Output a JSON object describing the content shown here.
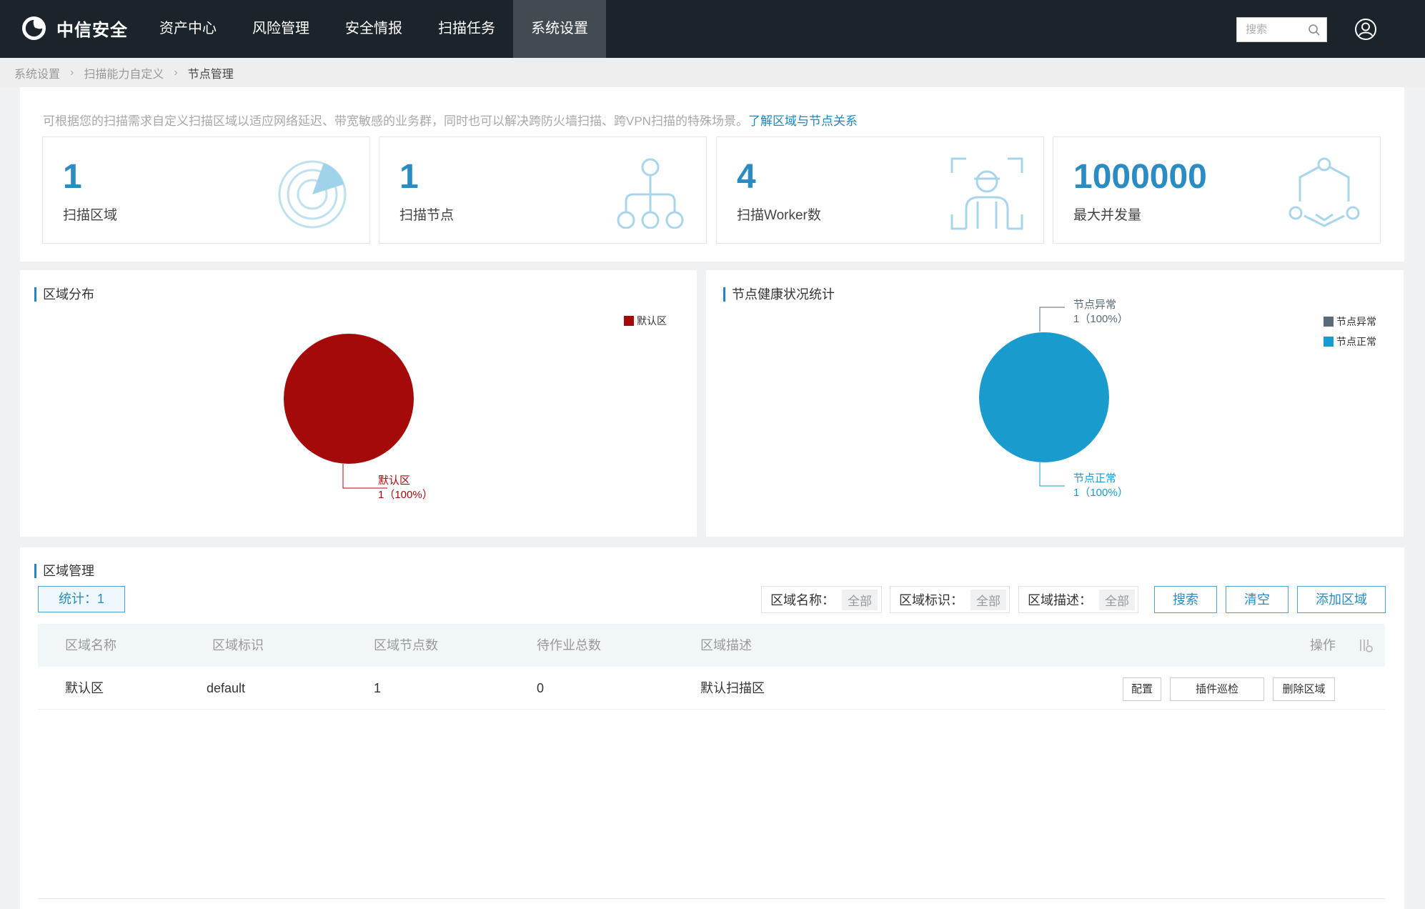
{
  "header": {
    "brand": "中信安全",
    "nav": [
      {
        "label": "资产中心",
        "active": false
      },
      {
        "label": "风险管理",
        "active": false
      },
      {
        "label": "安全情报",
        "active": false
      },
      {
        "label": "扫描任务",
        "active": false
      },
      {
        "label": "系统设置",
        "active": true
      }
    ],
    "search_placeholder": "搜索",
    "icons": {
      "search": "search-icon",
      "user": "user-icon",
      "logo": "logo-icon"
    }
  },
  "breadcrumb": [
    "系统设置",
    "扫描能力自定义",
    "节点管理"
  ],
  "intro": {
    "text": "可根据您的扫描需求自定义扫描区域以适应网络延迟、带宽敏感的业务群，同时也可以解决跨防火墙扫描、跨VPN扫描的特殊场景。",
    "link": "了解区域与节点关系"
  },
  "stats": [
    {
      "value": "1",
      "label": "扫描区域",
      "icon": "radar-icon"
    },
    {
      "value": "1",
      "label": "扫描节点",
      "icon": "node-tree-icon"
    },
    {
      "value": "4",
      "label": "扫描Worker数",
      "icon": "worker-icon"
    },
    {
      "value": "1000000",
      "label": "最大并发量",
      "icon": "concurrency-icon"
    }
  ],
  "zone_chart": {
    "title": "区域分布",
    "legend": [
      {
        "label": "默认区",
        "color": "#a50a0a"
      }
    ],
    "callout_name": "默认区",
    "callout_value": "1（100%）"
  },
  "health_chart": {
    "title": "节点健康状况统计",
    "legend": [
      {
        "label": "节点异常",
        "color": "#596a7a"
      },
      {
        "label": "节点正常",
        "color": "#1a9bce"
      }
    ],
    "callout_abnormal_name": "节点异常",
    "callout_abnormal_value": "1（100%）",
    "callout_normal_name": "节点正常",
    "callout_normal_value": "1（100%）"
  },
  "zone_mgmt": {
    "title": "区域管理",
    "count_label": "统计：1",
    "filters": [
      {
        "label": "区域名称：",
        "value": "全部"
      },
      {
        "label": "区域标识：",
        "value": "全部"
      },
      {
        "label": "区域描述：",
        "value": "全部"
      }
    ],
    "buttons": {
      "search": "搜索",
      "clear": "清空",
      "add": "添加区域"
    },
    "columns": [
      "区域名称",
      "区域标识",
      "区域节点数",
      "待作业总数",
      "区域描述",
      "操作"
    ],
    "rows": [
      {
        "name": "默认区",
        "id": "default",
        "nodes": "1",
        "pending": "0",
        "desc": "默认扫描区",
        "actions": [
          "配置",
          "插件巡检",
          "删除区域"
        ]
      }
    ]
  },
  "colors": {
    "accent": "#1f87c1",
    "zone_pie": "#a50a0a",
    "health_pie": "#1a9bce",
    "header_bg": "#1b232b"
  },
  "chart_data": [
    {
      "type": "pie",
      "title": "区域分布",
      "categories": [
        "默认区"
      ],
      "values": [
        1
      ]
    },
    {
      "type": "pie",
      "title": "节点健康状况统计",
      "categories": [
        "节点异常",
        "节点正常"
      ],
      "values": [
        0,
        1
      ]
    }
  ]
}
